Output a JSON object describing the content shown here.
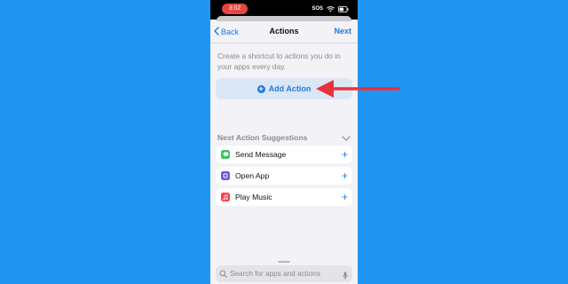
{
  "status_bar": {
    "time": "3:02",
    "carrier": "SOS"
  },
  "nav": {
    "back_label": "Back",
    "title": "Actions",
    "next_label": "Next"
  },
  "intro_text": "Create a shortcut to actions you do in your apps every day.",
  "add_action": {
    "label": "Add Action"
  },
  "suggestions": {
    "title": "Next Action Suggestions",
    "items": [
      {
        "label": "Send Message",
        "icon": "messages-icon",
        "color": "#34C759"
      },
      {
        "label": "Open App",
        "icon": "open-app-icon",
        "color": "#5E5CE6"
      },
      {
        "label": "Play Music",
        "icon": "music-icon",
        "color": "#FA3E52"
      }
    ]
  },
  "search": {
    "placeholder": "Search for apps and actions"
  },
  "colors": {
    "background": "#2096F2",
    "accent": "#1F7AE0",
    "arrow": "#E8323A"
  }
}
